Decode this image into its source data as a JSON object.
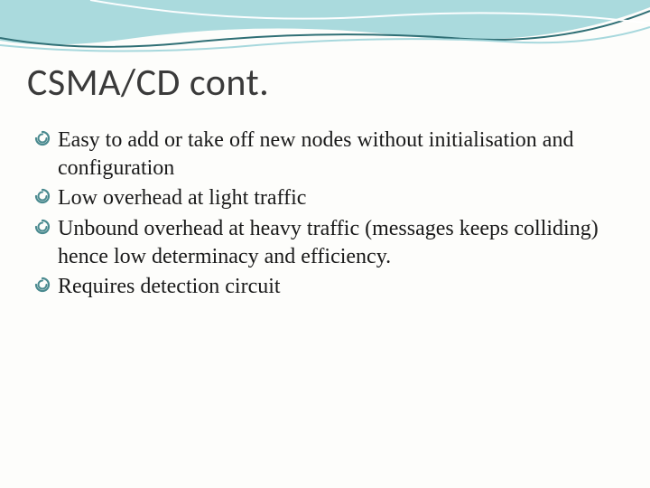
{
  "slide": {
    "title": "CSMA/CD cont.",
    "bullets": [
      "Easy to add or take off new nodes without initialisation and configuration",
      "Low overhead at light traffic",
      "Unbound overhead at heavy traffic (messages keeps colliding) hence low determinacy and efficiency.",
      "Requires detection circuit"
    ]
  },
  "theme": {
    "accent": "#4a8a8f",
    "wave_fill": "#8ecdd3",
    "wave_stroke": "#3a7a80"
  }
}
